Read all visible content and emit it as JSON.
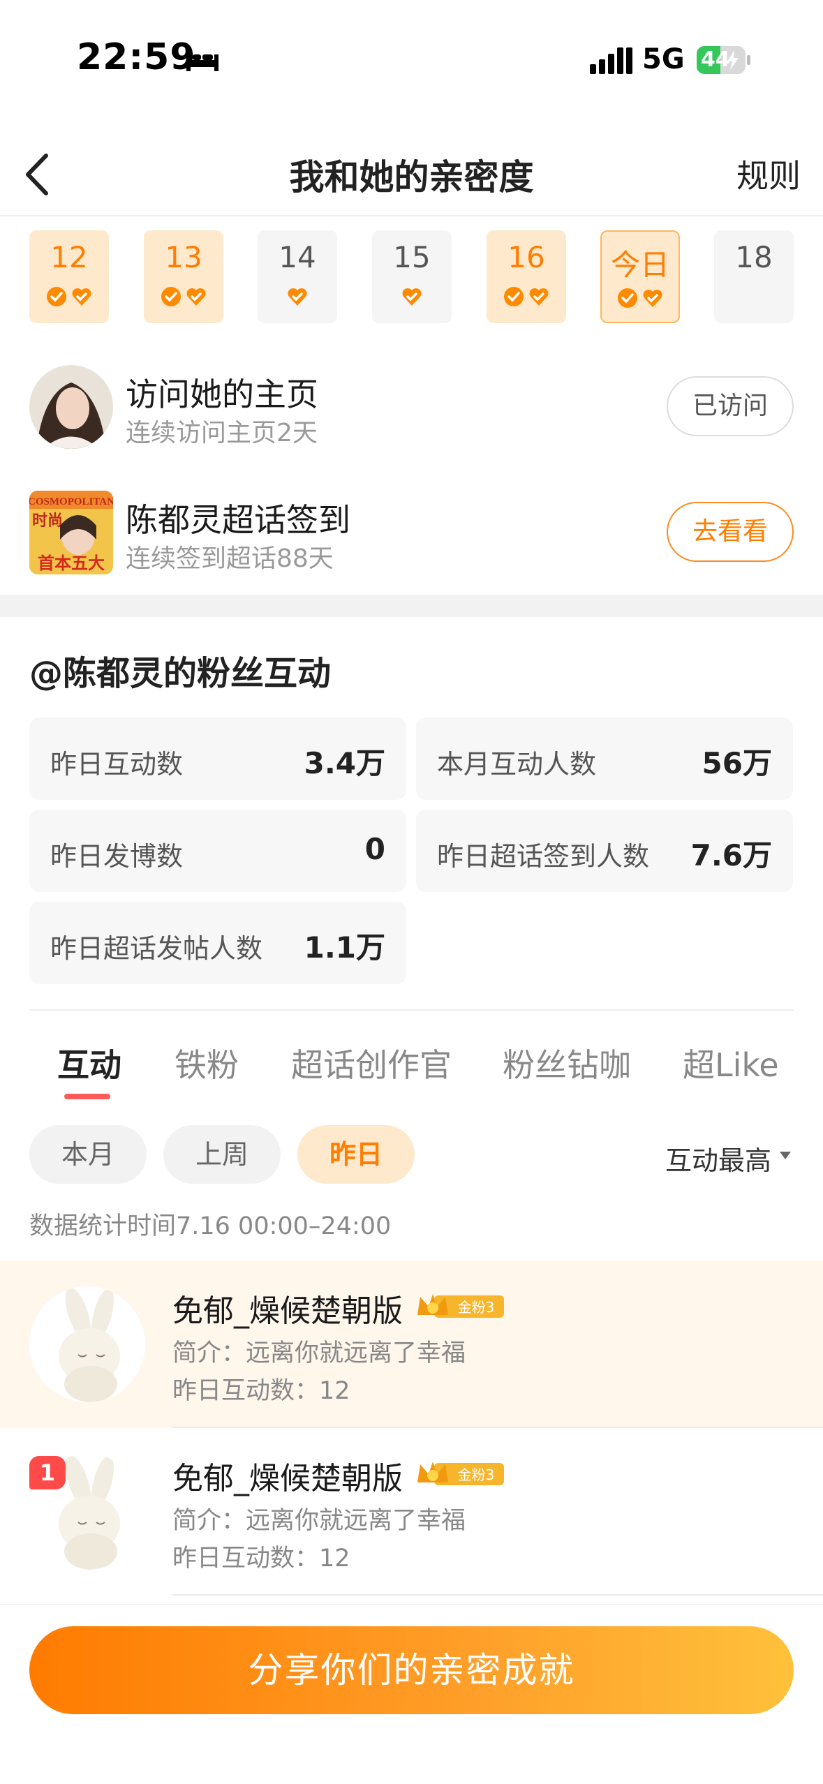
{
  "status_bar": {
    "time": "22:59",
    "network": "5G",
    "battery": "44"
  },
  "nav": {
    "title": "我和她的亲密度",
    "rules_label": "规则"
  },
  "dates": [
    {
      "label": "12",
      "state": "done",
      "checks": 2
    },
    {
      "label": "13",
      "state": "done",
      "checks": 2
    },
    {
      "label": "14",
      "state": "pending",
      "checks": 1
    },
    {
      "label": "15",
      "state": "pending",
      "checks": 1
    },
    {
      "label": "16",
      "state": "done",
      "checks": 2
    },
    {
      "label": "今日",
      "state": "today",
      "checks": 2
    },
    {
      "label": "18",
      "state": "future",
      "checks": 0
    }
  ],
  "tasks": [
    {
      "title": "访问她的主页",
      "subtitle": "连续访问主页2天",
      "button": "已访问"
    },
    {
      "title": "陈都灵超话签到",
      "subtitle": "连续签到超话88天",
      "button": "去看看",
      "cover_text_top": "COSMOPOLITAN",
      "cover_text_side": "时尚",
      "cover_text_bottom": "首本五大"
    }
  ],
  "fan_section": {
    "title": "@陈都灵的粉丝互动",
    "stats": [
      {
        "label": "昨日互动数",
        "value": "3.4万"
      },
      {
        "label": "本月互动人数",
        "value": "56万"
      },
      {
        "label": "昨日发博数",
        "value": "0"
      },
      {
        "label": "昨日超话签到人数",
        "value": "7.6万"
      },
      {
        "label": "昨日超话发帖人数",
        "value": "1.1万"
      }
    ]
  },
  "tabs": [
    "互动",
    "铁粉",
    "超话创作官",
    "粉丝钻咖",
    "超Like"
  ],
  "filters": {
    "chips": [
      "本月",
      "上周",
      "昨日"
    ],
    "active": "昨日",
    "sort_label": "互动最高",
    "stat_time": "数据统计时间7.16 00:00–24:00"
  },
  "fans": [
    {
      "name": "免郁_燥候楚朝版",
      "badge": "金粉3",
      "bio": "简介：远离你就远离了幸福",
      "count": "昨日互动数：12"
    },
    {
      "name": "免郁_燥候楚朝版",
      "badge": "金粉3",
      "bio": "简介：远离你就远离了幸福",
      "count": "昨日互动数：12",
      "rank": "1"
    }
  ],
  "share_button": "分享你们的亲密成就",
  "colors": {
    "accent": "#ff7d00",
    "chip_active_bg": "#ffe9cc",
    "tab_indicator": "#ff5a5a"
  }
}
